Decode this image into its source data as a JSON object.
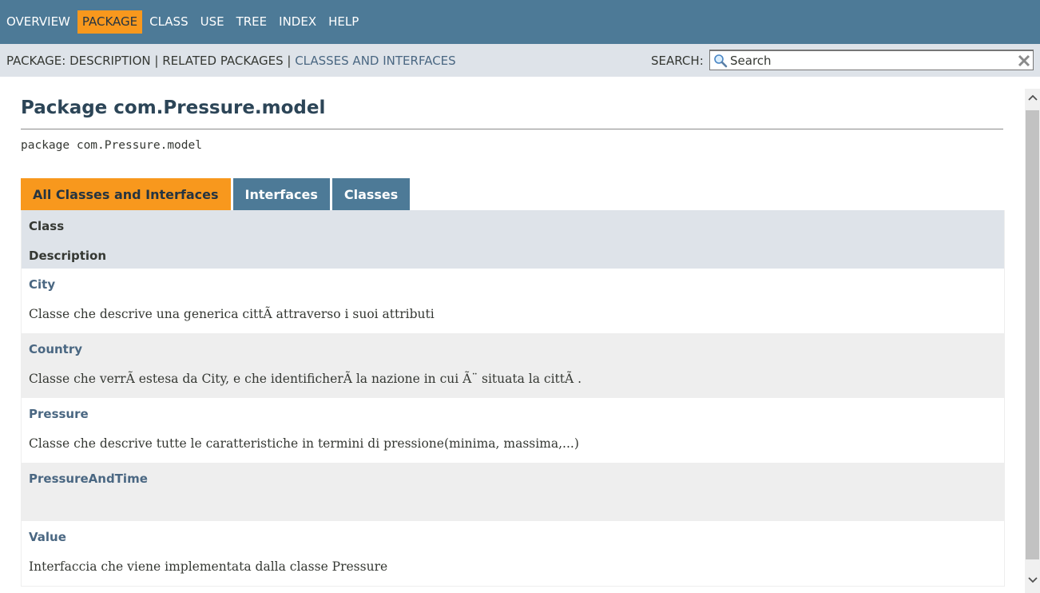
{
  "top_nav": {
    "items": [
      {
        "label": "OVERVIEW",
        "active": false
      },
      {
        "label": "PACKAGE",
        "active": true
      },
      {
        "label": "CLASS",
        "active": false
      },
      {
        "label": "USE",
        "active": false
      },
      {
        "label": "TREE",
        "active": false
      },
      {
        "label": "INDEX",
        "active": false
      },
      {
        "label": "HELP",
        "active": false
      }
    ]
  },
  "sub_nav": {
    "prefix": "PACKAGE: ",
    "description": "DESCRIPTION",
    "separator": " | ",
    "related": "RELATED PACKAGES",
    "classes_link": "CLASSES AND INTERFACES",
    "search_label": "SEARCH:",
    "search_placeholder": "Search"
  },
  "page": {
    "title": "Package com.Pressure.model",
    "signature": "package com.Pressure.model"
  },
  "tabs": [
    {
      "label": "All Classes and Interfaces",
      "active": true
    },
    {
      "label": "Interfaces",
      "active": false
    },
    {
      "label": "Classes",
      "active": false
    }
  ],
  "summary": {
    "header_class": "Class",
    "header_description": "Description",
    "rows": [
      {
        "name": "City",
        "description": "Classe che descrive una generica cittÃ  attraverso i suoi attributi"
      },
      {
        "name": "Country",
        "description": "Classe che verrÃ  estesa da City, e che identificherÃ  la nazione in cui Ã¨ situata la cittÃ ."
      },
      {
        "name": "Pressure",
        "description": "Classe che descrive tutte le caratteristiche in termini di pressione(minima, massima,...)"
      },
      {
        "name": "PressureAndTime",
        "description": ""
      },
      {
        "name": "Value",
        "description": "Interfaccia che viene implementata dalla classe Pressure"
      }
    ]
  },
  "colors": {
    "nav_bg": "#4d7a97",
    "active_tab": "#f8981d",
    "subnav_bg": "#dee3e9",
    "link": "#4a6782"
  },
  "icons": {
    "search": "search-icon",
    "reset": "close-icon",
    "scroll_up": "chevron-up-icon",
    "scroll_down": "chevron-down-icon"
  }
}
